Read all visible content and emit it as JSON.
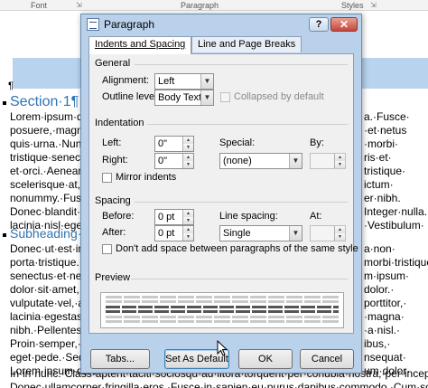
{
  "ribbon": {
    "groups": [
      "Font",
      "Paragraph",
      "Styles"
    ]
  },
  "document": {
    "pilcrow": "¶",
    "heading1": "Section·1¶",
    "section1_lines": [
      "Lorem·ipsum·dolo",
      "posuere,·magna·se",
      "quis·urna.·Nunc·vi",
      "tristique·senectus",
      "et·orci.·Aenean·ne",
      "scelerisque·at,·vu",
      "nonummy.·Fusce·a",
      "Donec·blandit·feu",
      "lacinia·nisl·eget·s"
    ],
    "section1_right": [
      "a.·Fusce·",
      "·et·netus",
      "·morbi·",
      "ris·et·",
      "tristique·",
      "ictum·",
      "er·nibh.",
      "Integer·nulla.·",
      "·Vestibulum·"
    ],
    "heading2": "Subheading·A¶",
    "section2_lines": [
      "Donec·ut·est·in·le",
      "porta·tristique.·P",
      "senectus·et·netus",
      "dolor·sit·amet,·co",
      "vulputate·vel,·auc",
      "lacinia·egestas·au",
      "nibh.·Pellentesque",
      "Proin·semper,·ante",
      "eget·pede.·Sed·ve",
      "Lorem·ipsum·dolo"
    ],
    "section2_right": [
      "a·non·",
      "morbi·tristique",
      "m·ipsum·",
      "dolor.·",
      "porttitor,·",
      "·magna·",
      "·a·nisl.·",
      "ibus,·",
      "nsequat·",
      "um·dolor·"
    ],
    "bottom_lines": [
      "In·in·nunc.·Class·aptent·taciti·sociosqu·ad·litora·torquent·per·conubia·nostra,·per·inceptos·hymenaeos.·",
      "Donec·ullamcorper·fringilla·eros.·Fusce·in·sapien·eu·purus·dapibus·commodo.·Cum·sociis·natoque·"
    ]
  },
  "dialog": {
    "title": "Paragraph",
    "help_label": "?",
    "close_label": "✕",
    "tabs": [
      {
        "label": "Indents and Spacing",
        "active": true
      },
      {
        "label": "Line and Page Breaks",
        "active": false
      }
    ],
    "general": {
      "label": "General",
      "alignment_label": "Alignment:",
      "alignment_value": "Left",
      "outline_label": "Outline level:",
      "outline_value": "Body Text",
      "collapsed_label": "Collapsed by default"
    },
    "indentation": {
      "label": "Indentation",
      "left_label": "Left:",
      "left_value": "0\"",
      "right_label": "Right:",
      "right_value": "0\"",
      "special_label": "Special:",
      "special_value": "(none)",
      "by_label": "By:",
      "by_value": "",
      "mirror_label": "Mirror indents"
    },
    "spacing": {
      "label": "Spacing",
      "before_label": "Before:",
      "before_value": "0 pt",
      "after_label": "After:",
      "after_value": "0 pt",
      "line_spacing_label": "Line spacing:",
      "line_spacing_value": "Single",
      "at_label": "At:",
      "at_value": "",
      "dont_add_label": "Don't add space between paragraphs of the same style"
    },
    "preview": {
      "label": "Preview"
    },
    "buttons": {
      "tabs": "Tabs...",
      "set_default": "Set As Default",
      "ok": "OK",
      "cancel": "Cancel"
    }
  },
  "colors": {
    "dialog_frame": "#b9d1ea",
    "heading_blue": "#2e74b5",
    "highlight_band": "#b8d3ed",
    "close_red": "#c7443a"
  }
}
